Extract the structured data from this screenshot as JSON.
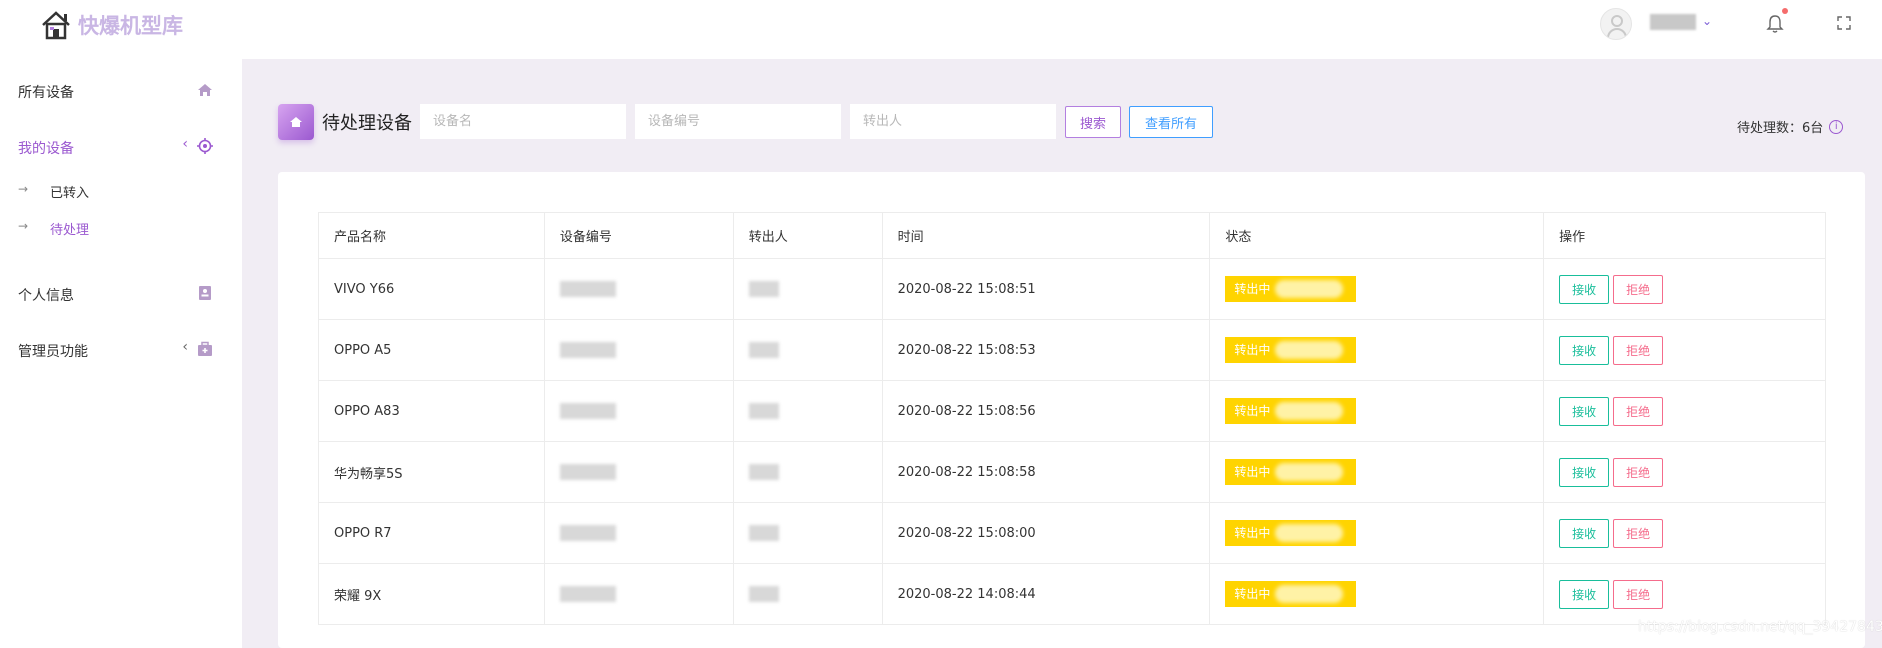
{
  "header": {
    "logo_text": "快爆机型库",
    "username": ""
  },
  "sidebar": {
    "items": [
      {
        "label": "所有设备",
        "icon": "home-icon"
      },
      {
        "label": "我的设备",
        "icon": "target-icon",
        "active": true
      },
      {
        "label": "个人信息",
        "icon": "contact-card-icon"
      },
      {
        "label": "管理员功能",
        "icon": "medical-bag-icon"
      }
    ],
    "sub_items": [
      {
        "label": "已转入"
      },
      {
        "label": "待处理",
        "active": true
      }
    ]
  },
  "main": {
    "title": "待处理设备",
    "search": {
      "name_placeholder": "设备名",
      "code_placeholder": "设备编号",
      "sender_placeholder": "转出人",
      "search_label": "搜索",
      "view_all_label": "查看所有"
    },
    "pending_count": "待处理数：6台",
    "table": {
      "headers": [
        "产品名称",
        "设备编号",
        "转出人",
        "时间",
        "状态",
        "操作"
      ],
      "rows": [
        {
          "product": "VIVO Y66",
          "time": "2020-08-22 15:08:51",
          "status": "转出中"
        },
        {
          "product": "OPPO A5",
          "time": "2020-08-22 15:08:53",
          "status": "转出中"
        },
        {
          "product": "OPPO A83",
          "time": "2020-08-22 15:08:56",
          "status": "转出中"
        },
        {
          "product": "华为畅享5S",
          "time": "2020-08-22 15:08:58",
          "status": "转出中"
        },
        {
          "product": "OPPO R7",
          "time": "2020-08-22 15:08:00",
          "status": "转出中"
        },
        {
          "product": "荣耀 9X",
          "time": "2020-08-22 14:08:44",
          "status": "转出中"
        }
      ],
      "accept_label": "接收",
      "reject_label": "拒绝"
    }
  },
  "watermark": "https://blog.csdn.net/qq_39427843",
  "colors": {
    "accent": "#9b59d0",
    "status": "#ffd400",
    "accept": "#19be9b",
    "reject": "#f56c8c",
    "view_all": "#409eff"
  }
}
